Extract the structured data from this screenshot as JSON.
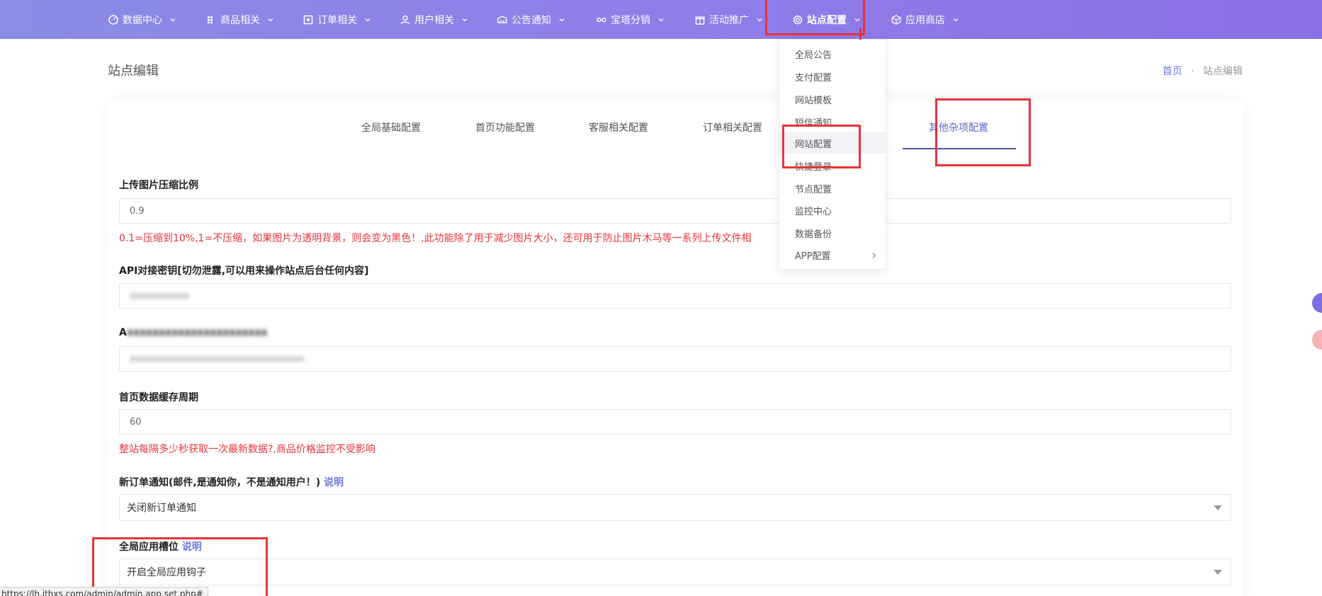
{
  "nav": {
    "items": [
      {
        "label": "数据中心",
        "icon": "dashboard-icon"
      },
      {
        "label": "商品相关",
        "icon": "grid-icon"
      },
      {
        "label": "订单相关",
        "icon": "order-icon"
      },
      {
        "label": "用户相关",
        "icon": "user-icon"
      },
      {
        "label": "公告通知",
        "icon": "notice-icon"
      },
      {
        "label": "宝塔分销",
        "icon": "distribution-icon"
      },
      {
        "label": "活动推广",
        "icon": "gift-icon"
      },
      {
        "label": "站点配置",
        "icon": "gear-icon",
        "active": true
      },
      {
        "label": "应用商店",
        "icon": "box-icon"
      }
    ]
  },
  "page": {
    "title": "站点编辑",
    "breadcrumb": {
      "home": "首页",
      "current": "站点编辑"
    }
  },
  "tabs": [
    {
      "label": "全局基础配置"
    },
    {
      "label": "首页功能配置"
    },
    {
      "label": "客服相关配置"
    },
    {
      "label": "订单相关配置"
    },
    {
      "label": "其他杂项配置",
      "active": true
    }
  ],
  "form": {
    "compress": {
      "label": "上传图片压缩比例",
      "value": "0.9",
      "hint": "0.1=压缩到10%,1=不压缩，如果图片为透明背景，则会变为黑色！,此功能除了用于减少图片大小，还可用于防止图片木马等一系列上传文件相"
    },
    "apikey": {
      "label": "API对接密钥[切勿泄露,可以用来操作站点后台任何内容]",
      "value": "xxxxxxxxxxx"
    },
    "third": {
      "label": "A",
      "label_blurred": "xxxxxxxxxxxxxxxxxxxxxx",
      "value": "xxxxxxxxxxxxxxxxxxxxxxxxxxxxxxxx"
    },
    "cache": {
      "label": "首页数据缓存周期",
      "value": "60",
      "hint": "整站每隔多少秒获取一次最新数据?,商品价格监控不受影响"
    },
    "order_notify": {
      "label": "新订单通知(邮件,是通知你，不是通知用户！)",
      "link": "说明",
      "selected": "关闭新订单通知"
    },
    "app_slot": {
      "label": "全局应用槽位",
      "link": "说明",
      "selected": "开启全局应用钩子"
    }
  },
  "dropdown": {
    "items": [
      {
        "label": "全局公告"
      },
      {
        "label": "支付配置"
      },
      {
        "label": "网站模板"
      },
      {
        "label": "短信通知"
      },
      {
        "label": "网站配置",
        "hover": true
      },
      {
        "label": "快捷登录"
      },
      {
        "label": "节点配置"
      },
      {
        "label": "监控中心"
      },
      {
        "label": "数据备份"
      },
      {
        "label": "APP配置",
        "submenu": true
      }
    ]
  },
  "statusbar": {
    "url": "https://lh.ithxs.com/admin/admin.app.set.php#"
  },
  "colors": {
    "nav_start": "#8a8ce6",
    "nav_end": "#8b6fe6",
    "accent": "#6c7ae0",
    "warning": "#e8333a"
  }
}
